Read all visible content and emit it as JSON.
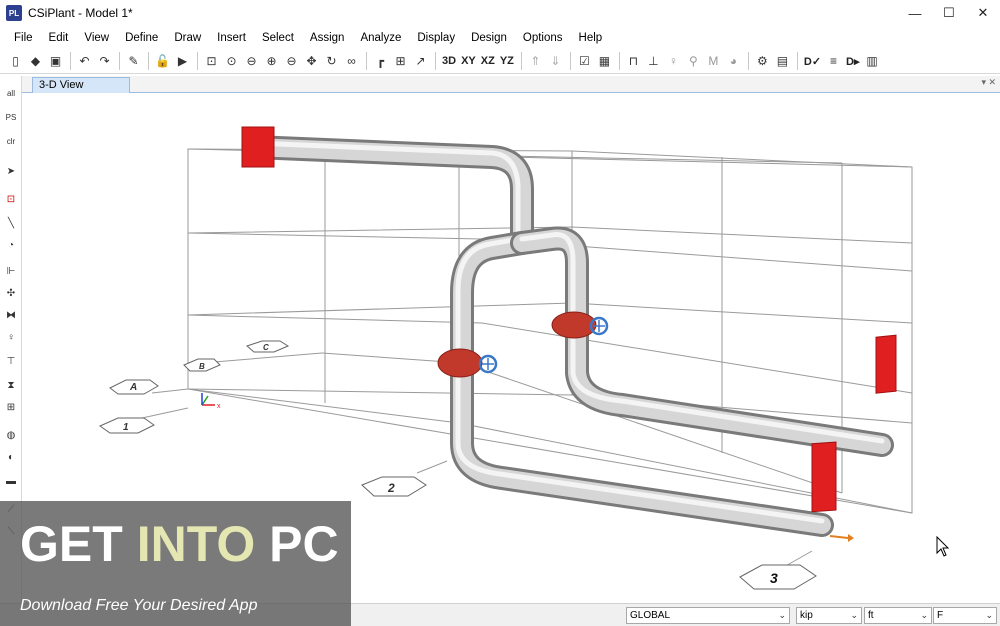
{
  "window": {
    "app_logo_text": "PL",
    "title": "CSiPlant - Model 1*",
    "controls": {
      "minimize": "—",
      "maximize": "☐",
      "close": "✕"
    }
  },
  "menu": [
    "File",
    "Edit",
    "View",
    "Define",
    "Draw",
    "Insert",
    "Select",
    "Assign",
    "Analyze",
    "Display",
    "Design",
    "Options",
    "Help"
  ],
  "toolbar": {
    "view_3d": "3D",
    "view_xy": "XY",
    "view_xz": "XZ",
    "view_yz": "YZ",
    "design_d1": "D✓",
    "design_d2": "D▸"
  },
  "left_toolbar": {
    "select_all": "all",
    "select_ps": "PS",
    "clear": "clr"
  },
  "tab": {
    "label": "3-D View",
    "controls": "▾ ✕"
  },
  "grid_bubbles": {
    "letters": [
      "A",
      "B",
      "C"
    ],
    "numbers": [
      "1",
      "2",
      "3"
    ]
  },
  "axis_labels": {
    "x": "x",
    "y": "y",
    "z": "z"
  },
  "statusbar": {
    "coord_system": "GLOBAL",
    "force_unit": "kip",
    "length_unit": "ft",
    "temp_unit": "F"
  },
  "watermark": {
    "title_a": "GET ",
    "title_b": "INTO",
    "title_c": " PC",
    "subtitle": "Download Free Your Desired App"
  },
  "colors": {
    "pipe": "#c8c8c8",
    "flange": "#e02020",
    "valve_body": "#c0392b",
    "valve_wheel": "#3a78c8",
    "grid": "#9a9a9a",
    "tab_bg": "#d5e6f8"
  }
}
